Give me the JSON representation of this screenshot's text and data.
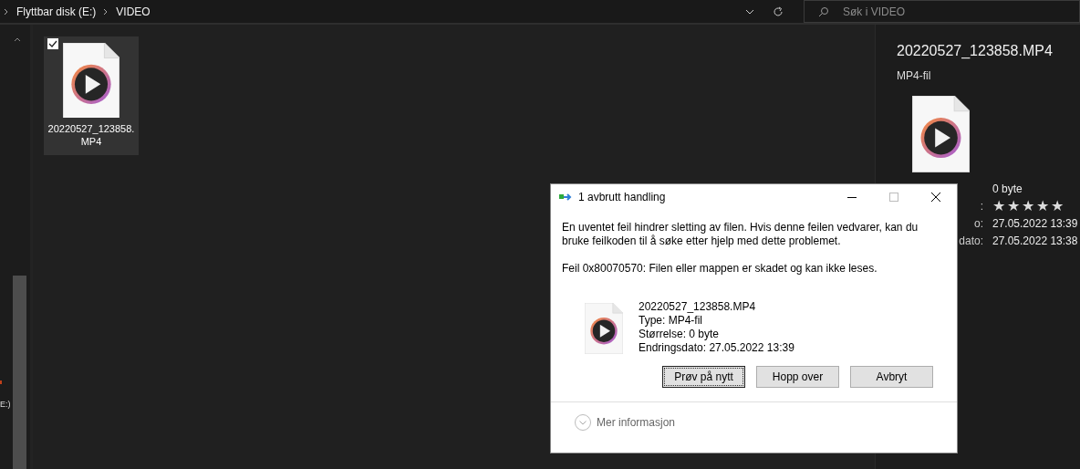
{
  "address_bar": {
    "breadcrumbs": [
      "Flyttbar disk (E:)",
      "VIDEO"
    ]
  },
  "search": {
    "placeholder": "Søk i VIDEO"
  },
  "nav_pane": {
    "items": [
      "E:)"
    ]
  },
  "files": [
    {
      "name": "20220527_123858.MP4",
      "selected": true,
      "checked": true
    }
  ],
  "details_pane": {
    "title": "20220527_123858.MP4",
    "type": "MP4-fil",
    "properties": [
      {
        "kind": "text",
        "value": "0 byte"
      },
      {
        "kind": "stars",
        "label": ":",
        "stars": 5
      },
      {
        "kind": "text",
        "label": "o:",
        "value": "27.05.2022 13:39"
      },
      {
        "kind": "text",
        "label": "dato:",
        "value": "27.05.2022 13:38"
      }
    ]
  },
  "dialog": {
    "title": "1 avbrutt handling",
    "message": "En uventet feil hindrer sletting av filen. Hvis denne feilen vedvarer, kan du bruke feilkoden til å søke etter hjelp med dette problemet.",
    "error": "Feil 0x80070570: Filen eller mappen er skadet og kan ikke leses.",
    "file": {
      "name": "20220527_123858.MP4",
      "type": "Type: MP4-fil",
      "size": "Størrelse: 0 byte",
      "modified": "Endringsdato: 27.05.2022 13:39"
    },
    "buttons": [
      {
        "label": "Prøv på nytt",
        "focused": true
      },
      {
        "label": "Hopp over",
        "focused": false
      },
      {
        "label": "Avbryt",
        "focused": false
      }
    ],
    "more_info": "Mer informasjon"
  }
}
